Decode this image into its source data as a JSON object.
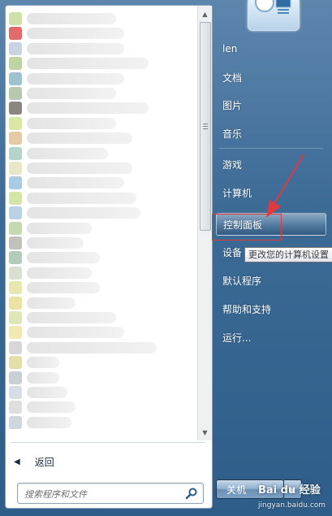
{
  "left_pane": {
    "back_label": "返回",
    "search_placeholder": "搜索程序和文件"
  },
  "right_pane": {
    "items": [
      {
        "label": "len"
      },
      {
        "label": "文档"
      },
      {
        "label": "图片"
      },
      {
        "label": "音乐"
      },
      {
        "label": "游戏"
      },
      {
        "label": "计算机"
      },
      {
        "label": "控制面板"
      },
      {
        "label": "设备"
      },
      {
        "label": "默认程序"
      },
      {
        "label": "帮助和支持"
      },
      {
        "label": "运行..."
      }
    ],
    "tooltip": "更改您的计算机设置",
    "shutdown_label": "关机"
  },
  "watermark": {
    "text": "Bai du 经验",
    "subtext": "jingyan.baidu.com"
  },
  "colors": {
    "highlight_border": "#e0393e",
    "menu_blue": "#3c6b96"
  }
}
